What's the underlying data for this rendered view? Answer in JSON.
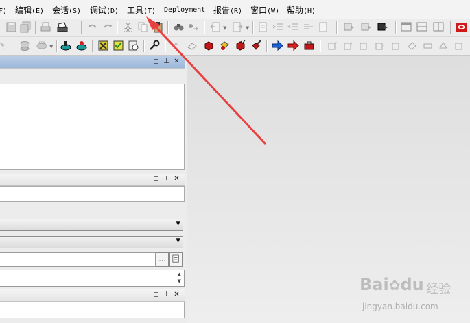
{
  "menubar": {
    "items": [
      {
        "label": "",
        "accel": "F)"
      },
      {
        "label": "编辑",
        "accel": "(E)"
      },
      {
        "label": "会话",
        "accel": "(S)"
      },
      {
        "label": "调试",
        "accel": "(D)"
      },
      {
        "label": "工具",
        "accel": "(T)"
      },
      {
        "label": "Deployment",
        "accel": ""
      },
      {
        "label": "报告",
        "accel": "(R)"
      },
      {
        "label": "窗口",
        "accel": "(W)"
      },
      {
        "label": "帮助",
        "accel": "(H)"
      }
    ]
  },
  "panels": {
    "top_buttons": [
      "◻",
      "⊥",
      "✕"
    ],
    "middle_buttons": [
      "◻",
      "⊥",
      "✕"
    ],
    "bottom_buttons": [
      "◻",
      "⊥",
      "✕"
    ]
  },
  "form": {
    "browse_label": "...",
    "spin_up": "▲",
    "spin_down": "▼",
    "combo_arrow": "▼"
  },
  "watermark": {
    "brand": "Bai",
    "brand2": "du",
    "cn": "经验",
    "url": "jingyan.baidu.com"
  },
  "colors": {
    "annotation_arrow": "#e84040",
    "panel_active": "#a8c0de"
  }
}
